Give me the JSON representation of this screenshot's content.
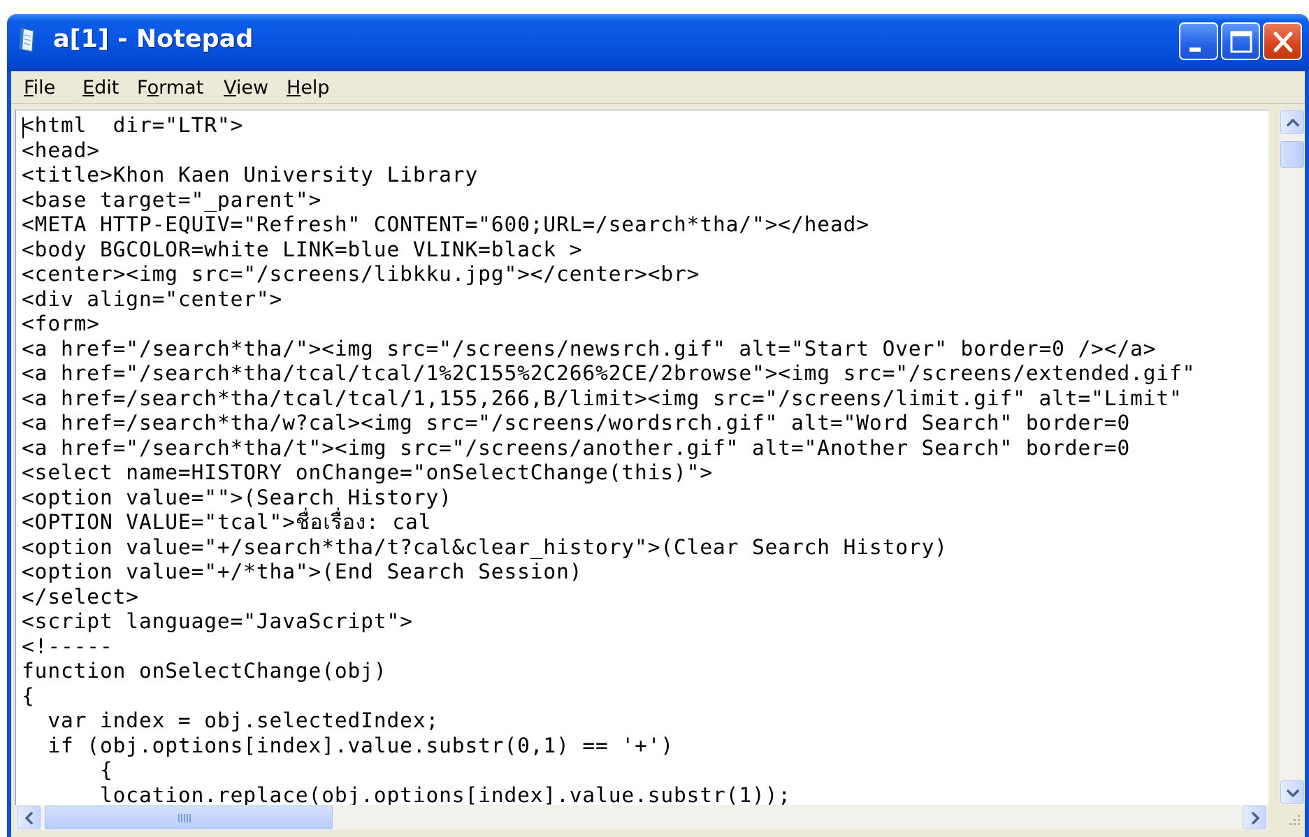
{
  "window": {
    "title": "a[1] - Notepad"
  },
  "menu": {
    "file": {
      "mnemonic": "F",
      "rest": "ile"
    },
    "edit": {
      "mnemonic": "E",
      "rest": "dit"
    },
    "format_pre": "F",
    "format_mnemonic": "o",
    "format_post": "rmat",
    "view": {
      "mnemonic": "V",
      "rest": "iew"
    },
    "help": {
      "mnemonic": "H",
      "rest": "elp"
    }
  },
  "editor": {
    "lines": [
      "<html  dir=\"LTR\">",
      "<head>",
      "<title>Khon Kaen University Library",
      "<base target=\"_parent\">",
      "<META HTTP-EQUIV=\"Refresh\" CONTENT=\"600;URL=/search*tha/\"></head>",
      "<body BGCOLOR=white LINK=blue VLINK=black >",
      "<center><img src=\"/screens/libkku.jpg\"></center><br>",
      "<div align=\"center\">",
      "<form>",
      "<a href=\"/search*tha/\"><img src=\"/screens/newsrch.gif\" alt=\"Start Over\" border=0 /></a>",
      "<a href=\"/search*tha/tcal/tcal/1%2C155%2C266%2CE/2browse\"><img src=\"/screens/extended.gif\"",
      "<a href=/search*tha/tcal/tcal/1,155,266,B/limit><img src=\"/screens/limit.gif\" alt=\"Limit\"",
      "<a href=/search*tha/w?cal><img src=\"/screens/wordsrch.gif\" alt=\"Word Search\" border=0",
      "<a href=\"/search*tha/t\"><img src=\"/screens/another.gif\" alt=\"Another Search\" border=0",
      "<select name=HISTORY onChange=\"onSelectChange(this)\">",
      "<option value=\"\">(Search History)",
      "<OPTION VALUE=\"tcal\">ชื่อเรื่อง: cal",
      "<option value=\"+/search*tha/t?cal&clear_history\">(Clear Search History)",
      "<option value=\"+/*tha\">(End Search Session)",
      "</select>",
      "<script language=\"JavaScript\">",
      "<!-----",
      "function onSelectChange(obj)",
      "{",
      "  var index = obj.selectedIndex;",
      "  if (obj.options[index].value.substr(0,1) == '+')",
      "      {",
      "      location.replace(obj.options[index].value.substr(1));"
    ]
  },
  "icons": {
    "app": "notepad-icon",
    "minimize": "minimize-icon",
    "maximize": "maximize-icon",
    "close": "close-icon",
    "scroll_up": "arrow-up-icon",
    "scroll_down": "arrow-down-icon",
    "scroll_left": "arrow-left-icon",
    "scroll_right": "arrow-right-icon"
  },
  "colors": {
    "titlebar": "#0854e0",
    "close_button": "#d8441c",
    "chrome": "#ece9d8"
  }
}
